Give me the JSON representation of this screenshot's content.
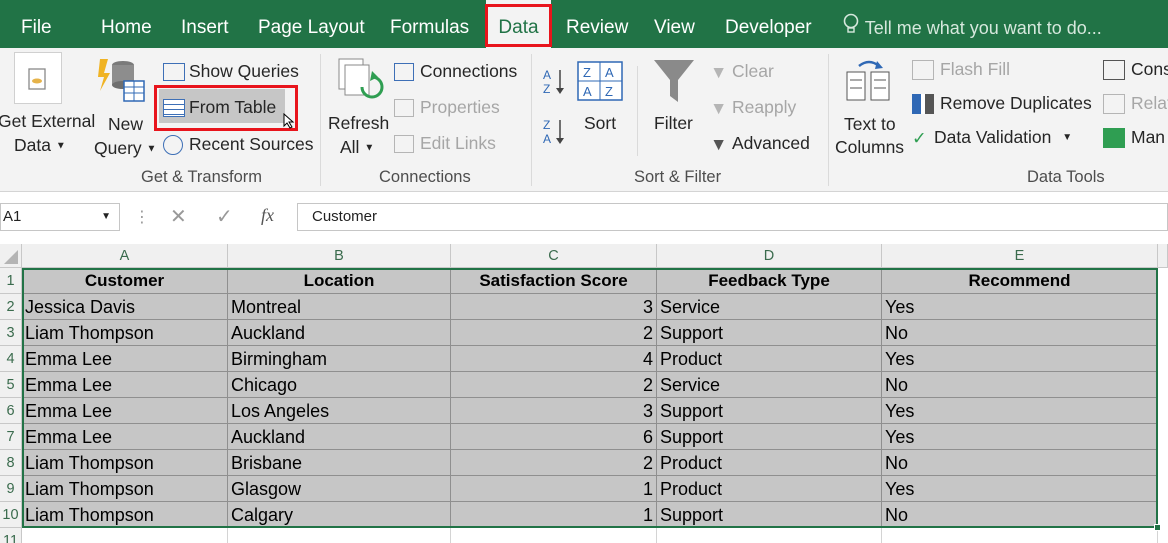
{
  "tabs": [
    {
      "label": "File"
    },
    {
      "label": "Home"
    },
    {
      "label": "Insert"
    },
    {
      "label": "Page Layout"
    },
    {
      "label": "Formulas"
    },
    {
      "label": "Data"
    },
    {
      "label": "Review"
    },
    {
      "label": "View"
    },
    {
      "label": "Developer"
    }
  ],
  "tell_me": "Tell me what you want to do...",
  "ribbon": {
    "get_transform": {
      "get_external_data": [
        "Get External",
        "Data"
      ],
      "new_query": [
        "New",
        "Query"
      ],
      "show_queries": "Show Queries",
      "from_table": "From Table",
      "recent_sources": "Recent Sources",
      "group_label": "Get & Transform"
    },
    "connections": {
      "refresh_all": [
        "Refresh",
        "All"
      ],
      "connections": "Connections",
      "properties": "Properties",
      "edit_links": "Edit Links",
      "group_label": "Connections"
    },
    "sort_filter": {
      "sort": "Sort",
      "filter": "Filter",
      "clear": "Clear",
      "reapply": "Reapply",
      "advanced": "Advanced",
      "group_label": "Sort & Filter"
    },
    "data_tools": {
      "text_to_columns": [
        "Text to",
        "Columns"
      ],
      "flash_fill": "Flash Fill",
      "remove_duplicates": "Remove Duplicates",
      "data_validation": "Data Validation",
      "consolidate": "Cons",
      "relationships": "Relat",
      "manage": "Man",
      "group_label": "Data Tools"
    }
  },
  "formula_bar": {
    "name_box": "A1",
    "fx": "fx",
    "content": "Customer"
  },
  "sheet": {
    "columns": [
      "A",
      "B",
      "C",
      "D",
      "E"
    ],
    "row_numbers": [
      "1",
      "2",
      "3",
      "4",
      "5",
      "6",
      "7",
      "8",
      "9",
      "10",
      "11"
    ],
    "header": [
      "Customer",
      "Location",
      "Satisfaction Score",
      "Feedback Type",
      "Recommend"
    ],
    "rows": [
      [
        "Jessica Davis",
        "Montreal",
        "3",
        "Service",
        "Yes"
      ],
      [
        "Liam Thompson",
        "Auckland",
        "2",
        "Support",
        "No"
      ],
      [
        "Emma Lee",
        "Birmingham",
        "4",
        "Product",
        "Yes"
      ],
      [
        "Emma Lee",
        "Chicago",
        "2",
        "Service",
        "No"
      ],
      [
        "Emma Lee",
        "Los Angeles",
        "3",
        "Support",
        "Yes"
      ],
      [
        "Emma Lee",
        "Auckland",
        "6",
        "Support",
        "Yes"
      ],
      [
        "Liam Thompson",
        "Brisbane",
        "2",
        "Product",
        "No"
      ],
      [
        "Liam Thompson",
        "Glasgow",
        "1",
        "Product",
        "Yes"
      ],
      [
        "Liam Thompson",
        "Calgary",
        "1",
        "Support",
        "No"
      ]
    ]
  },
  "colors": {
    "brand": "#217346",
    "highlight": "#e8141c",
    "table_fill": "#c6c6c6"
  }
}
